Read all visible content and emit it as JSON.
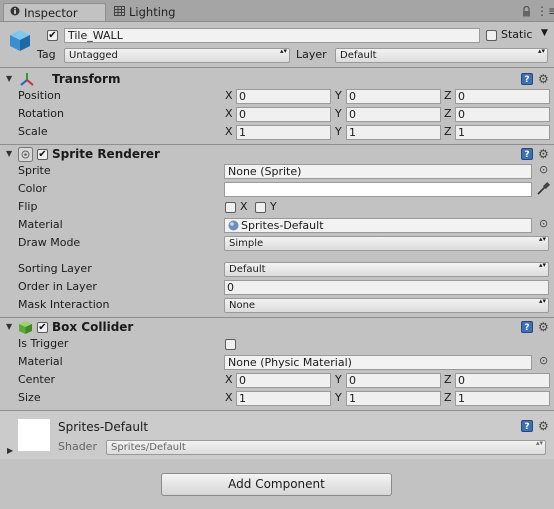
{
  "tabs": {
    "inspector": {
      "icon": "info-icon",
      "label": "Inspector"
    },
    "lighting": {
      "icon": "lighting-icon",
      "label": "Lighting"
    }
  },
  "game_object": {
    "active": true,
    "name": "Tile_WALL",
    "static_label": "Static",
    "static_checked": false,
    "tag_label": "Tag",
    "tag_value": "Untagged",
    "layer_label": "Layer",
    "layer_value": "Default"
  },
  "transform": {
    "title": "Transform",
    "rows": [
      {
        "label": "Position",
        "x": "0",
        "y": "0",
        "z": "0"
      },
      {
        "label": "Rotation",
        "x": "0",
        "y": "0",
        "z": "0"
      },
      {
        "label": "Scale",
        "x": "1",
        "y": "1",
        "z": "1"
      }
    ]
  },
  "axis": {
    "x": "X",
    "y": "Y",
    "z": "Z"
  },
  "sprite_renderer": {
    "title": "Sprite Renderer",
    "enabled": true,
    "sprite_label": "Sprite",
    "sprite_value": "None (Sprite)",
    "color_label": "Color",
    "color_value": "#ffffff",
    "flip_label": "Flip",
    "flip_x": "X",
    "flip_y": "Y",
    "material_label": "Material",
    "material_value": "Sprites-Default",
    "draw_mode_label": "Draw Mode",
    "draw_mode_value": "Simple",
    "sorting_layer_label": "Sorting Layer",
    "sorting_layer_value": "Default",
    "order_label": "Order in Layer",
    "order_value": "0",
    "mask_label": "Mask Interaction",
    "mask_value": "None"
  },
  "box_collider": {
    "title": "Box Collider",
    "enabled": true,
    "trigger_label": "Is Trigger",
    "trigger_checked": false,
    "material_label": "Material",
    "material_value": "None (Physic Material)",
    "center_label": "Center",
    "center": {
      "x": "0",
      "y": "0",
      "z": "0"
    },
    "size_label": "Size",
    "size": {
      "x": "1",
      "y": "1",
      "z": "1"
    }
  },
  "material_preview": {
    "name": "Sprites-Default",
    "shader_label": "Shader",
    "shader_value": "Sprites/Default"
  },
  "add_component_label": "Add Component",
  "colors": {
    "accent_blue": "#3d6fb5",
    "panel": "#c2c2c2"
  }
}
